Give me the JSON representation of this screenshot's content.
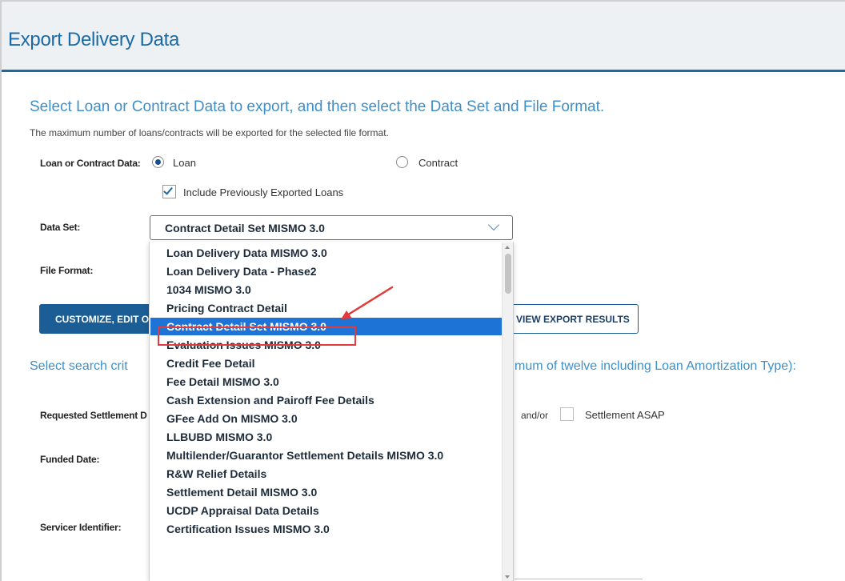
{
  "page": {
    "title": "Export Delivery Data"
  },
  "intro": {
    "heading": "Select Loan or Contract Data to export, and then select the Data Set and File Format.",
    "note": "The maximum number of loans/contracts will be exported for the selected file format."
  },
  "loan_contract": {
    "label": "Loan or Contract Data:",
    "options": [
      {
        "label": "Loan",
        "checked": true
      },
      {
        "label": "Contract",
        "checked": false
      }
    ],
    "include_previous_label": "Include Previously Exported Loans",
    "include_previous_checked": true
  },
  "data_set": {
    "label": "Data Set:",
    "selected": "Contract Detail Set MISMO 3.0",
    "options": [
      "Loan Delivery Data MISMO 3.0",
      "Loan Delivery Data - Phase2",
      "1034 MISMO 3.0",
      "Pricing Contract Detail",
      "Contract Detail Set MISMO 3.0",
      "Evaluation Issues MISMO 3.0",
      "Credit Fee Detail",
      "Fee Detail MISMO 3.0",
      "Cash Extension and Pairoff Fee Details",
      "GFee Add On MISMO 3.0",
      "LLBUBD MISMO 3.0",
      "Multilender/Guarantor Settlement Details MISMO 3.0",
      "R&W Relief Details",
      "Settlement Detail MISMO 3.0",
      "UCDP Appraisal Data Details",
      "Certification Issues MISMO 3.0"
    ],
    "selected_index": 4
  },
  "file_format": {
    "label": "File Format:"
  },
  "buttons": {
    "customize": "CUSTOMIZE, EDIT OR",
    "view_results": "VIEW EXPORT RESULTS"
  },
  "search": {
    "heading_left": "Select search crit",
    "heading_right": "mum of twelve including Loan Amortization Type):"
  },
  "criteria": {
    "requested_settlement_label": "Requested Settlement D",
    "and_or": "and/or",
    "settlement_asap_label": "Settlement ASAP",
    "settlement_asap_checked": false,
    "funded_date_label": "Funded Date:",
    "servicer_identifier_label": "Servicer Identifier:"
  },
  "colors": {
    "brand_blue": "#1b6aa5",
    "heading_blue": "#3f8fc8",
    "selected_option": "#1e74d6",
    "annotation_red": "#e23b3b"
  }
}
